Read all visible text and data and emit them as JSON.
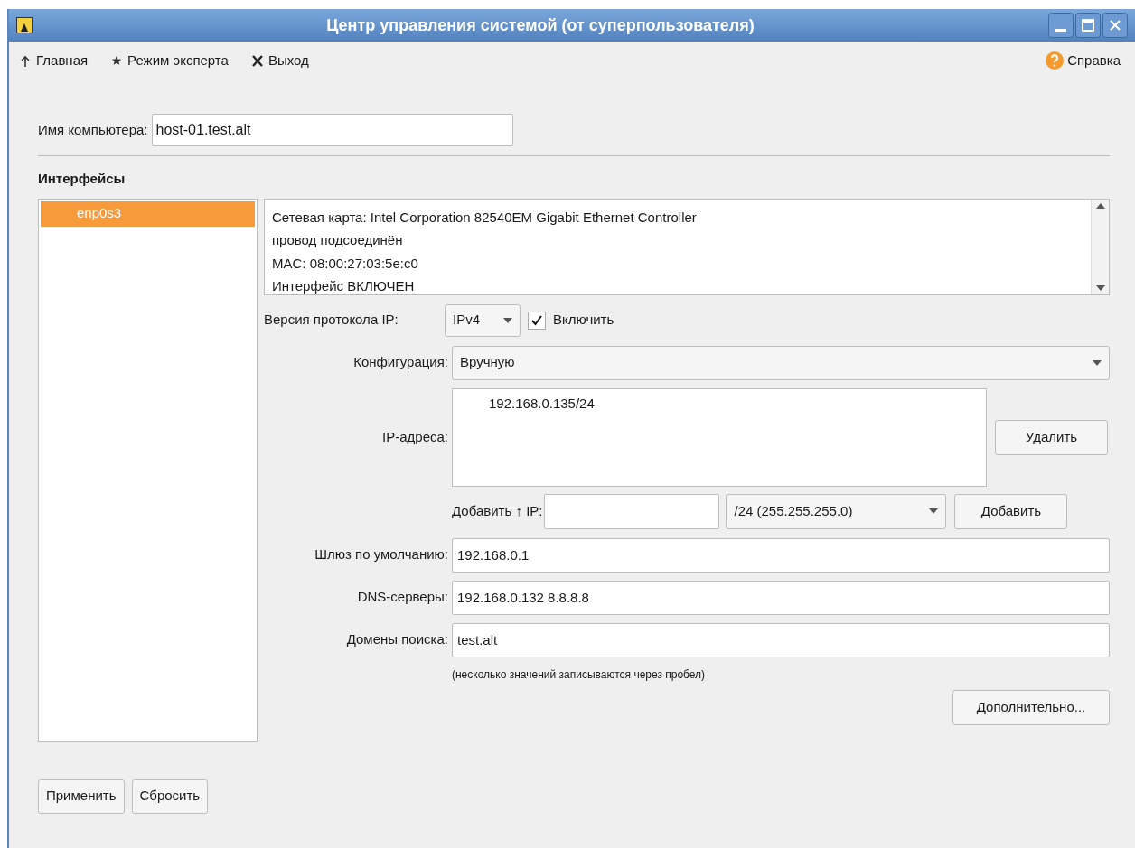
{
  "window": {
    "title": "Центр управления системой (от суперпользователя)"
  },
  "toolbar": [
    {
      "kind": "up",
      "label": "Главная"
    },
    {
      "kind": "star",
      "label": "Режим эксперта"
    },
    {
      "kind": "exit",
      "label": "Выход"
    }
  ],
  "help": {
    "label": "Справка"
  },
  "hostname": {
    "label": "Имя компьютера:",
    "value": "host-01.test.alt"
  },
  "interfaces": {
    "heading": "Интерфейсы",
    "items": [
      {
        "label": "enp0s3",
        "selected": true
      }
    ]
  },
  "info_lines": [
    "Сетевая карта: Intel Corporation 82540EM Gigabit Ethernet Controller",
    "провод подсоединён",
    "MAC: 08:00:27:03:5e:c0",
    "Интерфейс ВКЛЮЧЕН"
  ],
  "ip_version": {
    "label": "Версия протокола IP:",
    "value": "IPv4",
    "enable_label": "Включить",
    "checked": true
  },
  "configuration": {
    "label": "Конфигурация:",
    "value": "Вручную"
  },
  "ip_addresses": {
    "label": "IP-адреса:",
    "items": [
      "192.168.0.135/24"
    ],
    "delete_button": "Удалить"
  },
  "add_ip": {
    "label": "Добавить ↑ IP:",
    "mask": "/24 (255.255.255.0)",
    "button": "Добавить"
  },
  "fields": [
    {
      "label": "Шлюз по умолчанию:",
      "value": "192.168.0.1"
    },
    {
      "label": "DNS-серверы:",
      "value": "192.168.0.132 8.8.8.8"
    },
    {
      "label": "Домены поиска:",
      "value": "test.alt"
    }
  ],
  "hint": "(несколько значений записываются через пробел)",
  "advanced_button": "Дополнительно...",
  "buttons": [
    "Применить",
    "Сбросить"
  ]
}
